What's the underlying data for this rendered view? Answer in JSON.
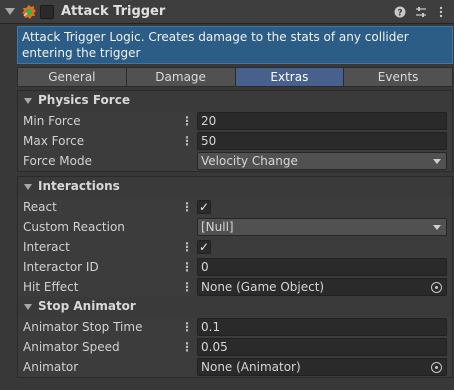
{
  "component": {
    "title": "Attack Trigger",
    "help_icon": "help-icon",
    "preset_icon": "preset-icon",
    "more_icon": "more-icon"
  },
  "info": {
    "text": "Attack Trigger Logic. Creates damage to the stats of any collider entering the trigger"
  },
  "tabs": [
    {
      "label": "General",
      "active": false
    },
    {
      "label": "Damage",
      "active": false
    },
    {
      "label": "Extras",
      "active": true
    },
    {
      "label": "Events",
      "active": false
    }
  ],
  "physics_force": {
    "title": "Physics Force",
    "min_force": {
      "label": "Min Force",
      "value": "20"
    },
    "max_force": {
      "label": "Max Force",
      "value": "50"
    },
    "force_mode": {
      "label": "Force Mode",
      "value": "Velocity Change"
    }
  },
  "interactions": {
    "title": "Interactions",
    "react": {
      "label": "React",
      "checked": true,
      "mark": "✓"
    },
    "custom_reaction": {
      "label": "Custom Reaction",
      "value": "[Null]"
    },
    "interact": {
      "label": "Interact",
      "checked": true,
      "mark": "✓"
    },
    "interactor_id": {
      "label": "Interactor ID",
      "value": "0"
    },
    "hit_effect": {
      "label": "Hit Effect",
      "value": "None (Game Object)"
    }
  },
  "stop_animator": {
    "title": "Stop Animator",
    "animator_stop_time": {
      "label": "Animator Stop Time",
      "value": "0.1"
    },
    "animator_speed": {
      "label": "Animator Speed",
      "value": "0.05"
    },
    "animator": {
      "label": "Animator",
      "value": "None (Animator)"
    }
  },
  "colors": {
    "info_bg": "#2c5d87",
    "active_tab": "#48608c",
    "panel_bg": "#383838"
  }
}
